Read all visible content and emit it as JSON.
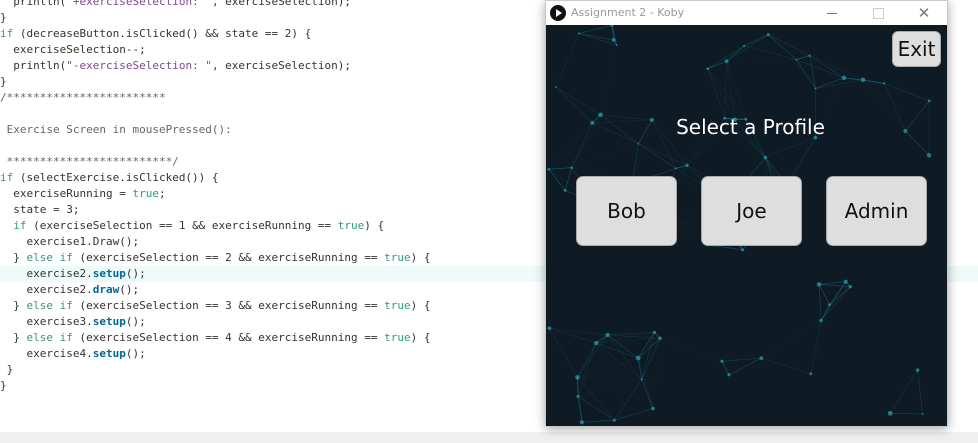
{
  "editor": {
    "lines": [
      [
        {
          "t": "  println(",
          "c": "plain"
        },
        {
          "t": "\"+exerciseSelection: \"",
          "c": "string"
        },
        {
          "t": ", exerciseSelection);",
          "c": "plain"
        }
      ],
      [
        {
          "t": "}",
          "c": "plain"
        }
      ],
      [
        {
          "t": "if",
          "c": "kw"
        },
        {
          "t": " (decreaseButton.isClicked() && state == 2) {",
          "c": "plain"
        }
      ],
      [
        {
          "t": "  exerciseSelection--;",
          "c": "plain"
        }
      ],
      [
        {
          "t": "  println(",
          "c": "plain"
        },
        {
          "t": "\"-exerciseSelection: \"",
          "c": "string"
        },
        {
          "t": ", exerciseSelection);",
          "c": "plain"
        }
      ],
      [
        {
          "t": "}",
          "c": "plain"
        }
      ],
      [
        {
          "t": "/************************",
          "c": "comment"
        }
      ],
      [
        {
          "t": "",
          "c": "plain"
        }
      ],
      [
        {
          "t": " Exercise Screen in mousePressed():",
          "c": "comment"
        }
      ],
      [
        {
          "t": "",
          "c": "plain"
        }
      ],
      [
        {
          "t": " *************************/",
          "c": "comment"
        }
      ],
      [
        {
          "t": "if",
          "c": "kw"
        },
        {
          "t": " (selectExercise.isClicked()) {",
          "c": "plain"
        }
      ],
      [
        {
          "t": "  exerciseRunning = ",
          "c": "plain"
        },
        {
          "t": "true",
          "c": "kw"
        },
        {
          "t": ";",
          "c": "plain"
        }
      ],
      [
        {
          "t": "  state = 3;",
          "c": "plain"
        }
      ],
      [
        {
          "t": "  if",
          "c": "kw"
        },
        {
          "t": " (exerciseSelection == 1 && exerciseRunning == ",
          "c": "plain"
        },
        {
          "t": "true",
          "c": "kw"
        },
        {
          "t": ") {",
          "c": "plain"
        }
      ],
      [
        {
          "t": "    exercise1.Draw();",
          "c": "plain"
        }
      ],
      [
        {
          "t": "  } ",
          "c": "plain"
        },
        {
          "t": "else if",
          "c": "kw"
        },
        {
          "t": " (exerciseSelection == 2 && exerciseRunning == ",
          "c": "plain"
        },
        {
          "t": "true",
          "c": "kw"
        },
        {
          "t": ") {",
          "c": "plain"
        }
      ],
      [
        {
          "t": "    exercise2.",
          "c": "plain"
        },
        {
          "t": "setup",
          "c": "fn"
        },
        {
          "t": "();",
          "c": "plain"
        }
      ],
      [
        {
          "t": "    exercise2.",
          "c": "plain"
        },
        {
          "t": "draw",
          "c": "fn"
        },
        {
          "t": "();",
          "c": "plain"
        }
      ],
      [
        {
          "t": "  } ",
          "c": "plain"
        },
        {
          "t": "else if",
          "c": "kw"
        },
        {
          "t": " (exerciseSelection == 3 && exerciseRunning == ",
          "c": "plain"
        },
        {
          "t": "true",
          "c": "kw"
        },
        {
          "t": ") {",
          "c": "plain"
        }
      ],
      [
        {
          "t": "    exercise3.",
          "c": "plain"
        },
        {
          "t": "setup",
          "c": "fn"
        },
        {
          "t": "();",
          "c": "plain"
        }
      ],
      [
        {
          "t": "  } ",
          "c": "plain"
        },
        {
          "t": "else if",
          "c": "kw"
        },
        {
          "t": " (exerciseSelection == 4 && exerciseRunning == ",
          "c": "plain"
        },
        {
          "t": "true",
          "c": "kw"
        },
        {
          "t": ") {",
          "c": "plain"
        }
      ],
      [
        {
          "t": "    exercise4.",
          "c": "plain"
        },
        {
          "t": "setup",
          "c": "fn"
        },
        {
          "t": "();",
          "c": "plain"
        }
      ],
      [
        {
          "t": " }",
          "c": "plain"
        }
      ],
      [
        {
          "t": "}",
          "c": "plain"
        }
      ]
    ],
    "current_line_index": 17
  },
  "window": {
    "title": "Assignment 2 - Koby",
    "icon": "processing-play-icon",
    "controls": {
      "minimize_icon": "minimize-icon",
      "maximize_icon": "maximize-icon",
      "close_icon": "close-icon",
      "close_glyph": "✕"
    }
  },
  "sketch": {
    "exit_label": "Exit",
    "heading": "Select a Profile",
    "profiles": [
      "Bob",
      "Joe",
      "Admin"
    ],
    "colors": {
      "background": "#0e1a24",
      "button_fill": "#dedede",
      "network": "#2aa3b0"
    }
  }
}
